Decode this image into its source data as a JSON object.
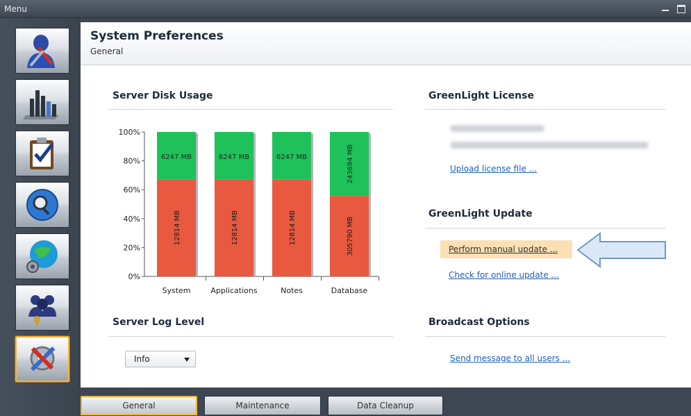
{
  "window": {
    "menu_label": "Menu"
  },
  "sidebar": {
    "items": [
      {
        "icon": "user-tools-icon"
      },
      {
        "icon": "bar-chart-icon"
      },
      {
        "icon": "clipboard-check-icon"
      },
      {
        "icon": "search-globe-icon"
      },
      {
        "icon": "globe-settings-icon"
      },
      {
        "icon": "users-key-icon"
      },
      {
        "icon": "tools-icon",
        "active": true
      }
    ]
  },
  "header": {
    "title": "System Preferences",
    "subtitle": "General"
  },
  "disk_usage": {
    "title": "Server Disk Usage"
  },
  "chart_data": {
    "type": "bar",
    "stacked": true,
    "categories": [
      "System",
      "Applications",
      "Notes",
      "Database"
    ],
    "series": [
      {
        "values": [
          12814,
          12814,
          12814,
          305790
        ],
        "labels": [
          "12814 MB",
          "12814 MB",
          "12814 MB",
          "305790 MB"
        ],
        "color": "#e8593f"
      },
      {
        "values": [
          6247,
          6247,
          6247,
          243694
        ],
        "labels": [
          "6247 MB",
          "6247 MB",
          "6247 MB",
          "243694 MB"
        ],
        "color": "#1fc25a"
      }
    ],
    "yticks": [
      "0%",
      "20%",
      "40%",
      "60%",
      "80%",
      "100%"
    ],
    "ylim": [
      0,
      100
    ],
    "grid": false
  },
  "license": {
    "title": "GreenLight License",
    "upload_link": "Upload license file ..."
  },
  "update": {
    "title": "GreenLight Update",
    "manual_link": "Perform manual update ...",
    "online_link": "Check for online update ..."
  },
  "log_level": {
    "title": "Server Log Level",
    "selected": "Info"
  },
  "broadcast": {
    "title": "Broadcast Options",
    "send_link": "Send message to all users ..."
  },
  "tabs": [
    {
      "label": "General",
      "active": true
    },
    {
      "label": "Maintenance"
    },
    {
      "label": "Data Cleanup"
    }
  ],
  "colors": {
    "accent": "#f4b43a",
    "link": "#1b5fbf",
    "used": "#e8593f",
    "free": "#1fc25a"
  }
}
